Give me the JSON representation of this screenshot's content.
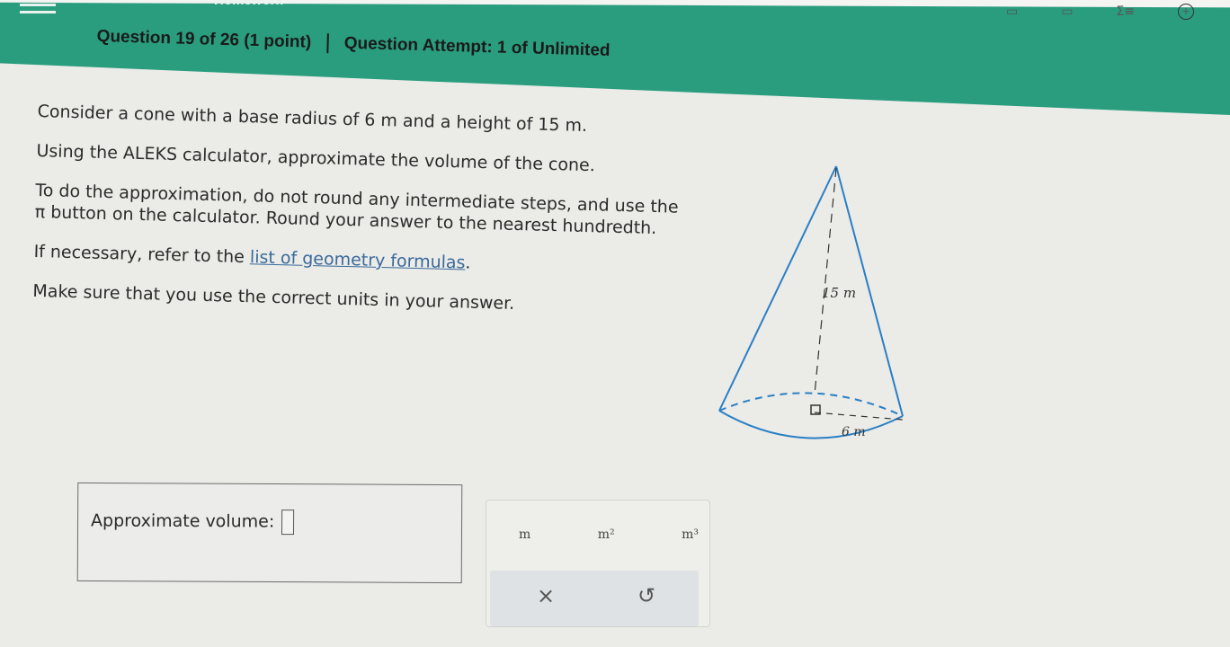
{
  "nav": {
    "title": "Homework",
    "menu_icon": "hamburger-icon"
  },
  "header": {
    "question": "Question 19 of 26 (1 point)",
    "attempt": "Question Attempt: 1 of Unlimited"
  },
  "toolbar_icons": [
    "book-icon",
    "book-icon",
    "sigma-icon",
    "plus-circle-icon"
  ],
  "problem": {
    "line1": "Consider a cone with a base radius of 6 m and a height of 15 m.",
    "line2": "Using the ALEKS calculator, approximate the volume of the cone.",
    "line3": "To do the approximation, do not round any intermediate steps, and use the π button on the calculator. Round your answer to the nearest hundredth.",
    "line4_prefix": "If necessary, refer to the ",
    "line4_link": "list of geometry formulas",
    "line4_suffix": ".",
    "line5": "Make sure that you use the correct units in your answer."
  },
  "figure": {
    "height_label": "15 m",
    "radius_label": "6 m"
  },
  "answer": {
    "label": "Approximate volume:",
    "value": ""
  },
  "units": {
    "u1": "m",
    "u2": "m²",
    "u3": "m³"
  },
  "controls": {
    "clear": "×",
    "undo": "↺"
  },
  "colors": {
    "header_bg": "#2a9d7e",
    "link": "#3a6a9a",
    "cone_stroke": "#2a7fc4"
  }
}
